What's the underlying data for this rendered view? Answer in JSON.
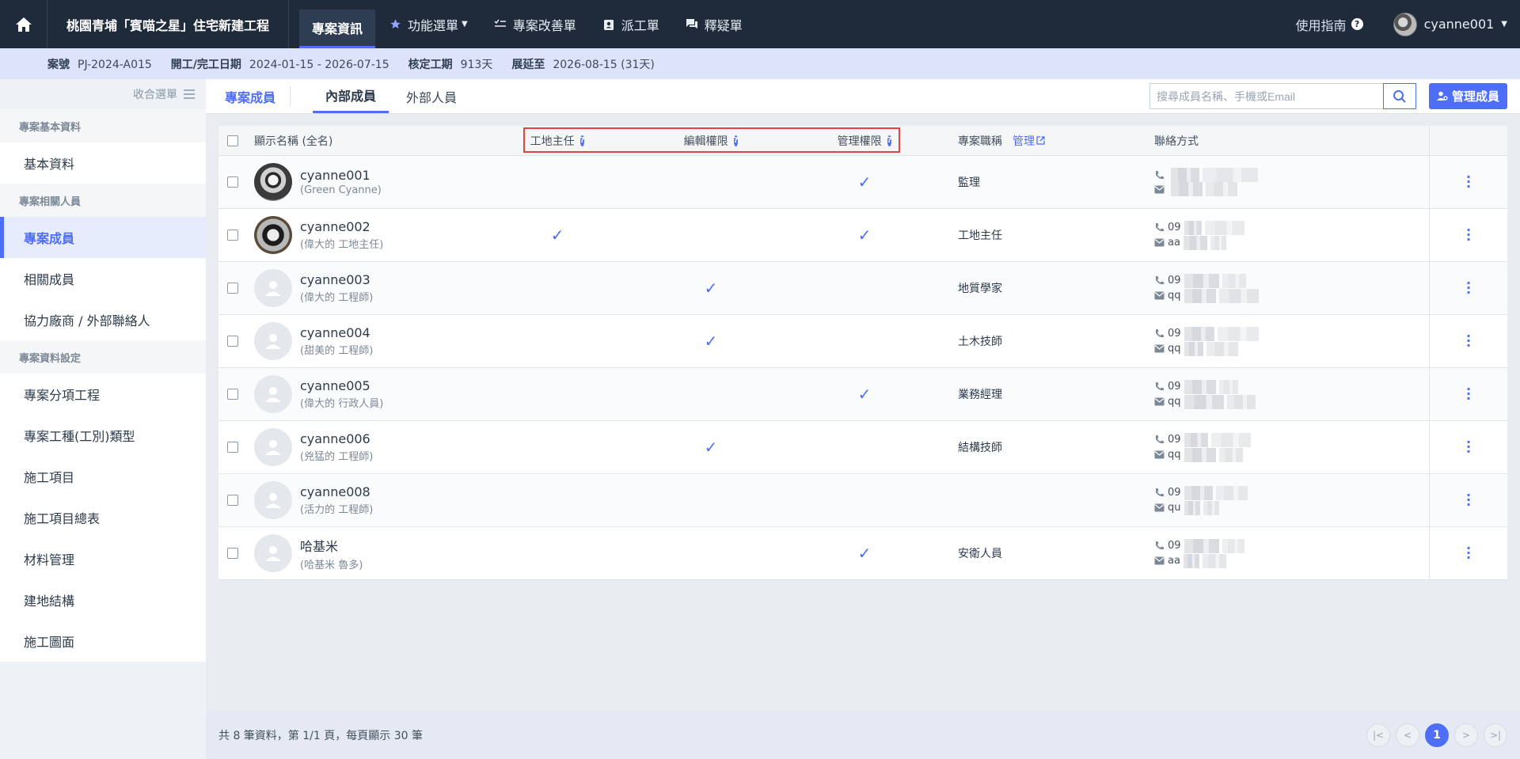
{
  "topbar": {
    "home_icon": "home-icon",
    "project_title": "桃園青埔「賓喵之星」住宅新建工程",
    "tabs": [
      {
        "label": "專案資訊",
        "icon": ""
      },
      {
        "label": "功能選單",
        "icon": "star-icon"
      },
      {
        "label": "專案改善單",
        "icon": "checklist-icon"
      },
      {
        "label": "派工單",
        "icon": "badge-icon"
      },
      {
        "label": "釋疑單",
        "icon": "chat-icon"
      }
    ],
    "guide_label": "使用指南",
    "username": "cyanne001"
  },
  "infobar": {
    "case_no_label": "案號",
    "case_no": "PJ-2024-A015",
    "dates_label": "開工/完工日期",
    "dates": "2024-01-15 - 2026-07-15",
    "period_label": "核定工期",
    "period": "913天",
    "extend_label": "展延至",
    "extend": "2026-08-15 (31天)"
  },
  "sidebar": {
    "collapse_label": "收合選單",
    "groups": [
      {
        "title": "專案基本資料",
        "items": [
          "基本資料"
        ]
      },
      {
        "title": "專案相關人員",
        "items": [
          "專案成員",
          "相關成員",
          "協力廠商 / 外部聯絡人"
        ]
      },
      {
        "title": "專案資料設定",
        "items": [
          "專案分項工程",
          "專案工種(工別)類型",
          "施工項目",
          "施工項目總表",
          "材料管理",
          "建地結構",
          "施工圖面"
        ]
      }
    ]
  },
  "subbar": {
    "title": "專案成員",
    "tab_internal": "內部成員",
    "tab_external": "外部人員",
    "search_placeholder": "搜尋成員名稱、手機或Email",
    "manage_label": "管理成員"
  },
  "table": {
    "headers": {
      "name": "顯示名稱 (全名)",
      "site": "工地主任",
      "edit": "編輯權限",
      "admin": "管理權限",
      "title": "專案職稱",
      "title_link": "管理",
      "contact": "聯絡方式"
    },
    "rows": [
      {
        "name": "cyanne001",
        "full": "(Green Cyanne)",
        "site": "",
        "edit": "",
        "admin": "✓",
        "title": "監理",
        "phone": "",
        "email": ""
      },
      {
        "name": "cyanne002",
        "full": "(偉大的 工地主任)",
        "site": "✓",
        "edit": "",
        "admin": "✓",
        "title": "工地主任",
        "phone": "09",
        "email": "aa"
      },
      {
        "name": "cyanne003",
        "full": "(偉大的 工程師)",
        "site": "",
        "edit": "✓",
        "admin": "",
        "title": "地質學家",
        "phone": "09",
        "email": "qq"
      },
      {
        "name": "cyanne004",
        "full": "(甜美的 工程師)",
        "site": "",
        "edit": "✓",
        "admin": "",
        "title": "土木技師",
        "phone": "09",
        "email": "qq"
      },
      {
        "name": "cyanne005",
        "full": "(偉大的 行政人員)",
        "site": "",
        "edit": "",
        "admin": "✓",
        "title": "業務經理",
        "phone": "09",
        "email": "qq"
      },
      {
        "name": "cyanne006",
        "full": "(兇猛的 工程師)",
        "site": "",
        "edit": "✓",
        "admin": "",
        "title": "結構技師",
        "phone": "09",
        "email": "qq"
      },
      {
        "name": "cyanne008",
        "full": "(活力的 工程師)",
        "site": "",
        "edit": "",
        "admin": "",
        "title": "",
        "phone": "09",
        "email": "qu"
      },
      {
        "name": "哈基米",
        "full": "(哈基米 魯多)",
        "site": "",
        "edit": "",
        "admin": "✓",
        "title": "安衛人員",
        "phone": "09",
        "email": "aa"
      }
    ]
  },
  "footer": {
    "summary": "共 8 筆資料，第 1/1 頁，每頁顯示 30 筆",
    "current_page": "1"
  },
  "colors": {
    "accent": "#4f6ef7",
    "topbar": "#1f2b3a",
    "highlight": "#e5443e"
  }
}
